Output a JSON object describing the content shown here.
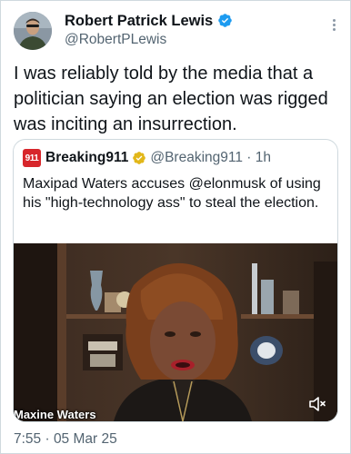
{
  "author": {
    "name": "Robert Patrick Lewis",
    "handle": "@RobertPLewis",
    "verified_color": "#1d9bf0"
  },
  "tweet": {
    "text": "I was reliably told by the media that a politician saying an election was rigged was inciting an insurrection.",
    "timestamp": "7:55 · 05 Mar 25"
  },
  "quoted_tweet": {
    "avatar_label": "911",
    "name": "Breaking911",
    "handle": "@Breaking911",
    "separator": "·",
    "time_ago": "1h",
    "verified_color": "#e2b719",
    "text": "Maxipad Waters accuses @elonmusk of using his \"high-technology ass\" to steal the election.",
    "media": {
      "caption": "Maxine Waters",
      "icon": "volume-muted-icon"
    }
  },
  "icons": {
    "more": "more-options-icon",
    "verified": "verified-badge-icon"
  }
}
